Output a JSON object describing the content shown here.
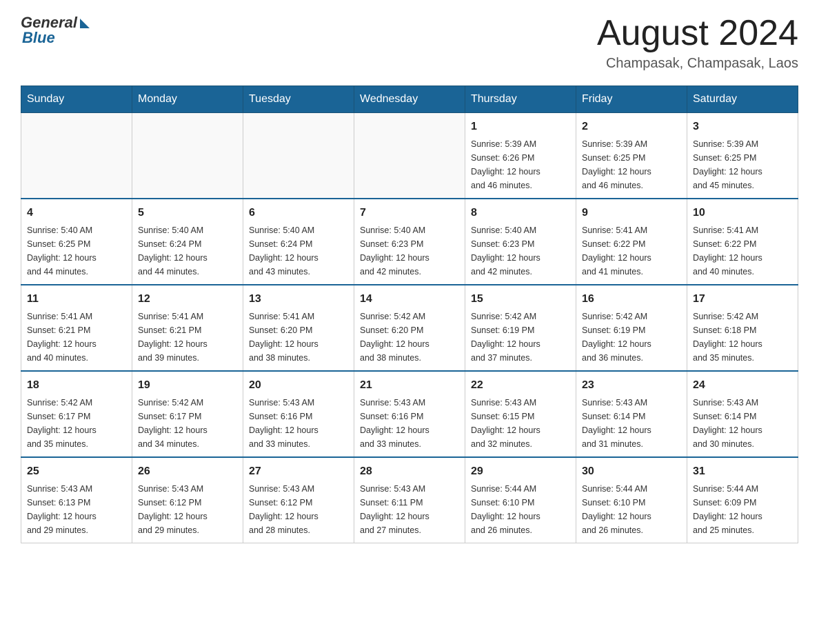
{
  "logo": {
    "general": "General",
    "blue": "Blue"
  },
  "title": "August 2024",
  "location": "Champasak, Champasak, Laos",
  "days_of_week": [
    "Sunday",
    "Monday",
    "Tuesday",
    "Wednesday",
    "Thursday",
    "Friday",
    "Saturday"
  ],
  "weeks": [
    [
      {
        "day": "",
        "info": ""
      },
      {
        "day": "",
        "info": ""
      },
      {
        "day": "",
        "info": ""
      },
      {
        "day": "",
        "info": ""
      },
      {
        "day": "1",
        "info": "Sunrise: 5:39 AM\nSunset: 6:26 PM\nDaylight: 12 hours\nand 46 minutes."
      },
      {
        "day": "2",
        "info": "Sunrise: 5:39 AM\nSunset: 6:25 PM\nDaylight: 12 hours\nand 46 minutes."
      },
      {
        "day": "3",
        "info": "Sunrise: 5:39 AM\nSunset: 6:25 PM\nDaylight: 12 hours\nand 45 minutes."
      }
    ],
    [
      {
        "day": "4",
        "info": "Sunrise: 5:40 AM\nSunset: 6:25 PM\nDaylight: 12 hours\nand 44 minutes."
      },
      {
        "day": "5",
        "info": "Sunrise: 5:40 AM\nSunset: 6:24 PM\nDaylight: 12 hours\nand 44 minutes."
      },
      {
        "day": "6",
        "info": "Sunrise: 5:40 AM\nSunset: 6:24 PM\nDaylight: 12 hours\nand 43 minutes."
      },
      {
        "day": "7",
        "info": "Sunrise: 5:40 AM\nSunset: 6:23 PM\nDaylight: 12 hours\nand 42 minutes."
      },
      {
        "day": "8",
        "info": "Sunrise: 5:40 AM\nSunset: 6:23 PM\nDaylight: 12 hours\nand 42 minutes."
      },
      {
        "day": "9",
        "info": "Sunrise: 5:41 AM\nSunset: 6:22 PM\nDaylight: 12 hours\nand 41 minutes."
      },
      {
        "day": "10",
        "info": "Sunrise: 5:41 AM\nSunset: 6:22 PM\nDaylight: 12 hours\nand 40 minutes."
      }
    ],
    [
      {
        "day": "11",
        "info": "Sunrise: 5:41 AM\nSunset: 6:21 PM\nDaylight: 12 hours\nand 40 minutes."
      },
      {
        "day": "12",
        "info": "Sunrise: 5:41 AM\nSunset: 6:21 PM\nDaylight: 12 hours\nand 39 minutes."
      },
      {
        "day": "13",
        "info": "Sunrise: 5:41 AM\nSunset: 6:20 PM\nDaylight: 12 hours\nand 38 minutes."
      },
      {
        "day": "14",
        "info": "Sunrise: 5:42 AM\nSunset: 6:20 PM\nDaylight: 12 hours\nand 38 minutes."
      },
      {
        "day": "15",
        "info": "Sunrise: 5:42 AM\nSunset: 6:19 PM\nDaylight: 12 hours\nand 37 minutes."
      },
      {
        "day": "16",
        "info": "Sunrise: 5:42 AM\nSunset: 6:19 PM\nDaylight: 12 hours\nand 36 minutes."
      },
      {
        "day": "17",
        "info": "Sunrise: 5:42 AM\nSunset: 6:18 PM\nDaylight: 12 hours\nand 35 minutes."
      }
    ],
    [
      {
        "day": "18",
        "info": "Sunrise: 5:42 AM\nSunset: 6:17 PM\nDaylight: 12 hours\nand 35 minutes."
      },
      {
        "day": "19",
        "info": "Sunrise: 5:42 AM\nSunset: 6:17 PM\nDaylight: 12 hours\nand 34 minutes."
      },
      {
        "day": "20",
        "info": "Sunrise: 5:43 AM\nSunset: 6:16 PM\nDaylight: 12 hours\nand 33 minutes."
      },
      {
        "day": "21",
        "info": "Sunrise: 5:43 AM\nSunset: 6:16 PM\nDaylight: 12 hours\nand 33 minutes."
      },
      {
        "day": "22",
        "info": "Sunrise: 5:43 AM\nSunset: 6:15 PM\nDaylight: 12 hours\nand 32 minutes."
      },
      {
        "day": "23",
        "info": "Sunrise: 5:43 AM\nSunset: 6:14 PM\nDaylight: 12 hours\nand 31 minutes."
      },
      {
        "day": "24",
        "info": "Sunrise: 5:43 AM\nSunset: 6:14 PM\nDaylight: 12 hours\nand 30 minutes."
      }
    ],
    [
      {
        "day": "25",
        "info": "Sunrise: 5:43 AM\nSunset: 6:13 PM\nDaylight: 12 hours\nand 29 minutes."
      },
      {
        "day": "26",
        "info": "Sunrise: 5:43 AM\nSunset: 6:12 PM\nDaylight: 12 hours\nand 29 minutes."
      },
      {
        "day": "27",
        "info": "Sunrise: 5:43 AM\nSunset: 6:12 PM\nDaylight: 12 hours\nand 28 minutes."
      },
      {
        "day": "28",
        "info": "Sunrise: 5:43 AM\nSunset: 6:11 PM\nDaylight: 12 hours\nand 27 minutes."
      },
      {
        "day": "29",
        "info": "Sunrise: 5:44 AM\nSunset: 6:10 PM\nDaylight: 12 hours\nand 26 minutes."
      },
      {
        "day": "30",
        "info": "Sunrise: 5:44 AM\nSunset: 6:10 PM\nDaylight: 12 hours\nand 26 minutes."
      },
      {
        "day": "31",
        "info": "Sunrise: 5:44 AM\nSunset: 6:09 PM\nDaylight: 12 hours\nand 25 minutes."
      }
    ]
  ]
}
